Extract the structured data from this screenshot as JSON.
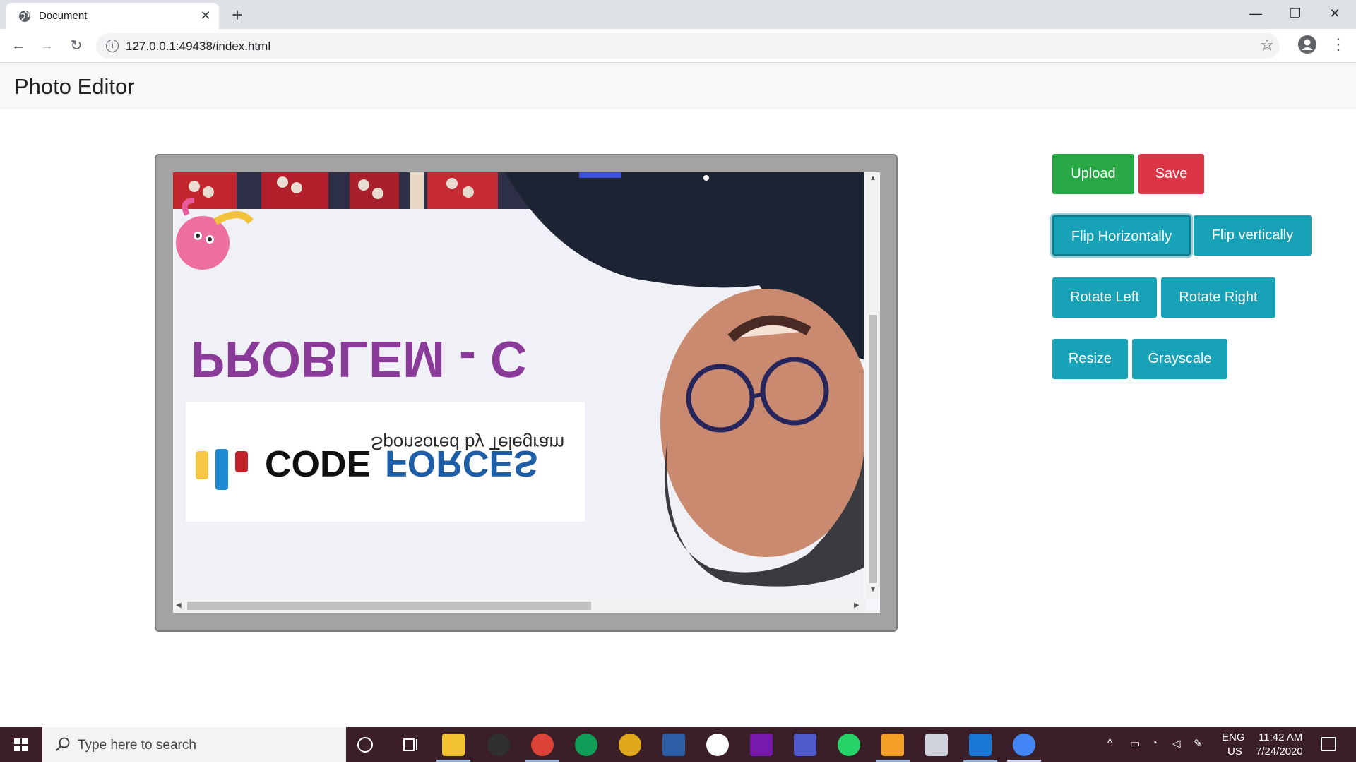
{
  "browser": {
    "tab_title": "Document",
    "tab_close": "✕",
    "new_tab": "+",
    "url": "127.0.0.1:49438/index.html",
    "window_controls": {
      "minimize": "—",
      "restore": "❐",
      "close": "✕"
    }
  },
  "page": {
    "title": "Photo Editor"
  },
  "editor": {
    "image_text": {
      "problem_heading": "PROBLEM - C",
      "sponsor": "Sponsored by Telegram",
      "brand_left": "CODE",
      "brand_right": "FORCES"
    },
    "transform": "flipped vertically"
  },
  "controls": {
    "upload": "Upload",
    "save": "Save",
    "flip_h": "Flip Horizontally",
    "flip_v": "Flip vertically",
    "rotate_left": "Rotate Left",
    "rotate_right": "Rotate Right",
    "resize": "Resize",
    "grayscale": "Grayscale"
  },
  "colors": {
    "success": "#28a745",
    "danger": "#dc3545",
    "info": "#17a2b8"
  },
  "taskbar": {
    "search_placeholder": "Type here to search",
    "lang_top": "ENG",
    "lang_bottom": "US",
    "time": "11:42 AM",
    "date": "7/24/2020"
  }
}
